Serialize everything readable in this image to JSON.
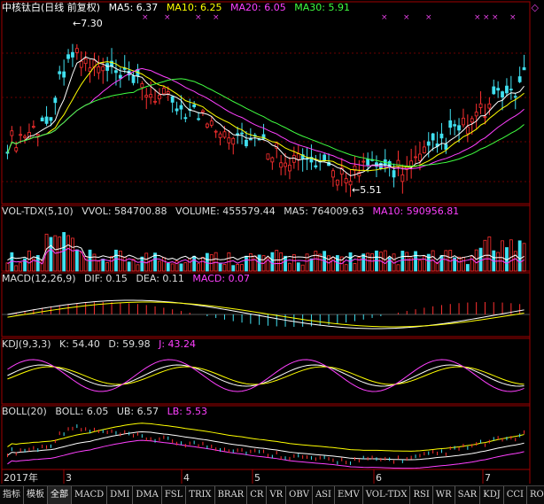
{
  "main_header": {
    "title": "中核钛白(日线 前复权)",
    "items": [
      {
        "label": "MA5: 6.37",
        "color": "#ffffff"
      },
      {
        "label": "MA10: 6.25",
        "color": "#ffff00"
      },
      {
        "label": "MA20: 6.05",
        "color": "#ff40ff"
      },
      {
        "label": "MA30: 5.91",
        "color": "#40ff40"
      }
    ]
  },
  "vol_header": {
    "title": "VOL-TDX(5,10)",
    "items": [
      {
        "label": "VVOL: 584700.88",
        "color": "#ffffff"
      },
      {
        "label": "VOLUME: 455579.44",
        "color": "#ffffff"
      },
      {
        "label": "MA5: 764009.63",
        "color": "#ffffff"
      },
      {
        "label": "MA10: 590956.81",
        "color": "#ff40ff"
      }
    ]
  },
  "macd_header": {
    "title": "MACD(12,26,9)",
    "items": [
      {
        "label": "DIF: 0.15",
        "color": "#ffffff"
      },
      {
        "label": "DEA: 0.11",
        "color": "#ffffff"
      },
      {
        "label": "MACD: 0.07",
        "color": "#ff40ff"
      }
    ]
  },
  "kdj_header": {
    "title": "KDJ(9,3,3)",
    "items": [
      {
        "label": "K: 54.40",
        "color": "#ffffff"
      },
      {
        "label": "D: 59.98",
        "color": "#ffffff"
      },
      {
        "label": "J: 43.24",
        "color": "#ff40ff"
      }
    ]
  },
  "boll_header": {
    "title": "BOLL(20)",
    "items": [
      {
        "label": "BOLL: 6.05",
        "color": "#ffffff"
      },
      {
        "label": "UB: 6.57",
        "color": "#ffffff"
      },
      {
        "label": "LB: 5.53",
        "color": "#ff40ff"
      }
    ]
  },
  "annotations": {
    "high": "7.30",
    "low": "5.51"
  },
  "x_axis": [
    "2017年",
    "3",
    "4",
    "5",
    "6",
    "7"
  ],
  "price_range": [
    5.3,
    7.4
  ],
  "colors": {
    "up": "#ff3030",
    "down": "#40e0f0",
    "ma5": "#ffffff",
    "ma10": "#ffff00",
    "ma20": "#ff40ff",
    "ma30": "#40ff40",
    "grid": "#6b0000",
    "axis": "#a00000"
  },
  "tabs": [
    "指标",
    "模板",
    "全部",
    "MACD",
    "DMI",
    "DMA",
    "FSL",
    "TRIX",
    "BRAR",
    "CR",
    "VR",
    "OBV",
    "ASI",
    "EMV",
    "VOL-TDX",
    "RSI",
    "WR",
    "SAR",
    "KDJ",
    "CCI",
    "ROC"
  ],
  "active_tab": "全部",
  "scroll_icon": "chevron-right-icon",
  "diamond_icon": "diamond-icon",
  "diamond_glyph": "◇"
}
